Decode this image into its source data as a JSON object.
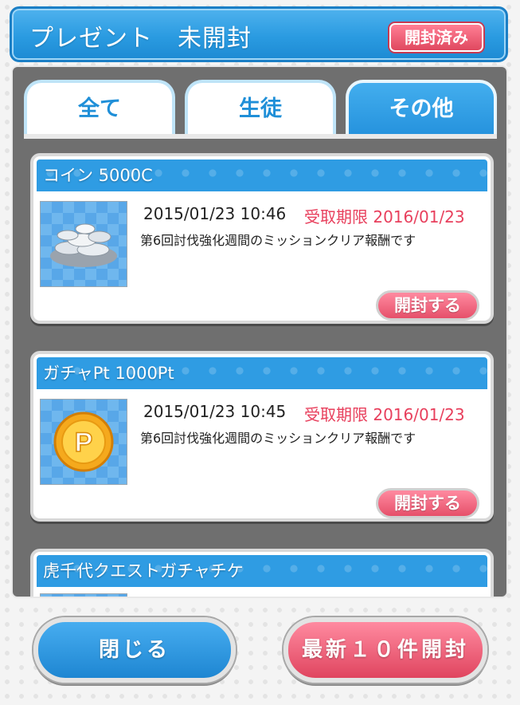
{
  "header": {
    "title": "プレゼント　未開封",
    "opened_button": "開封済み"
  },
  "tabs": [
    {
      "label": "全て",
      "active": false
    },
    {
      "label": "生徒",
      "active": false
    },
    {
      "label": "その他",
      "active": true
    }
  ],
  "items": [
    {
      "name": "コイン 5000C",
      "icon": "silver-coins-icon",
      "date": "2015/01/23 10:46",
      "deadline": "受取期限 2016/01/23",
      "description": "第6回討伐強化週間のミッションクリア報酬です",
      "action": "開封する"
    },
    {
      "name": "ガチャPt 1000Pt",
      "icon": "gacha-point-coin-icon",
      "date": "2015/01/23 10:45",
      "deadline": "受取期限 2016/01/23",
      "description": "第6回討伐強化週間のミッションクリア報酬です",
      "action": "開封する"
    },
    {
      "name": "虎千代クエストガチャチケ"
    }
  ],
  "footer": {
    "close_label": "閉じる",
    "open_latest_label": "最新１０件開封"
  },
  "colors": {
    "accent_blue": "#2a9be1",
    "accent_pink": "#e6506a",
    "deadline_red": "#e8405d"
  }
}
